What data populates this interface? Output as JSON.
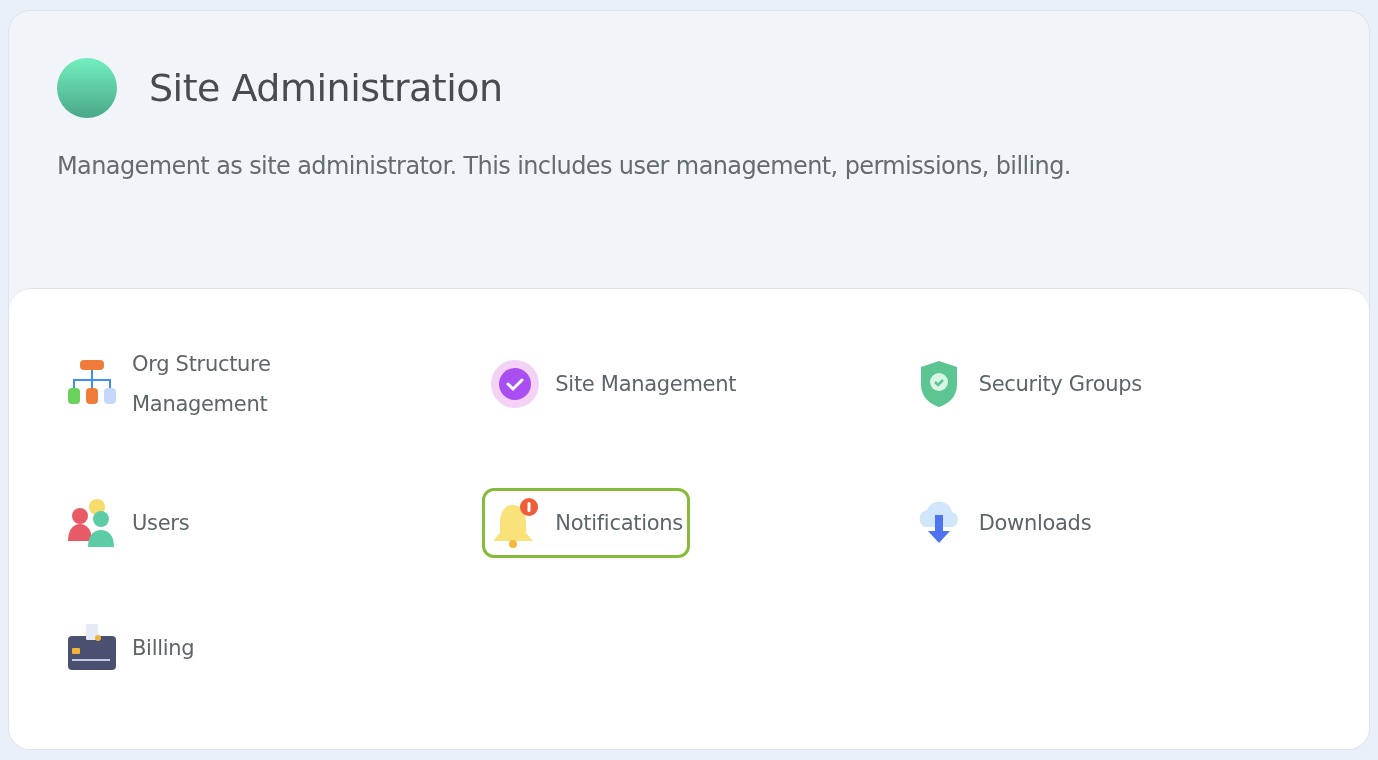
{
  "header": {
    "title": "Site Administration",
    "description": "Management as site administrator. This includes user management, permissions, billing."
  },
  "items": [
    {
      "kind": "org",
      "label": "Org Structure Management",
      "selected": false
    },
    {
      "kind": "site",
      "label": "Site Management",
      "selected": false
    },
    {
      "kind": "security",
      "label": "Security Groups",
      "selected": false
    },
    {
      "kind": "users",
      "label": "Users",
      "selected": false
    },
    {
      "kind": "notifications",
      "label": "Notifications",
      "selected": true
    },
    {
      "kind": "downloads",
      "label": "Downloads",
      "selected": false
    },
    {
      "kind": "billing",
      "label": "Billing",
      "selected": false
    }
  ]
}
